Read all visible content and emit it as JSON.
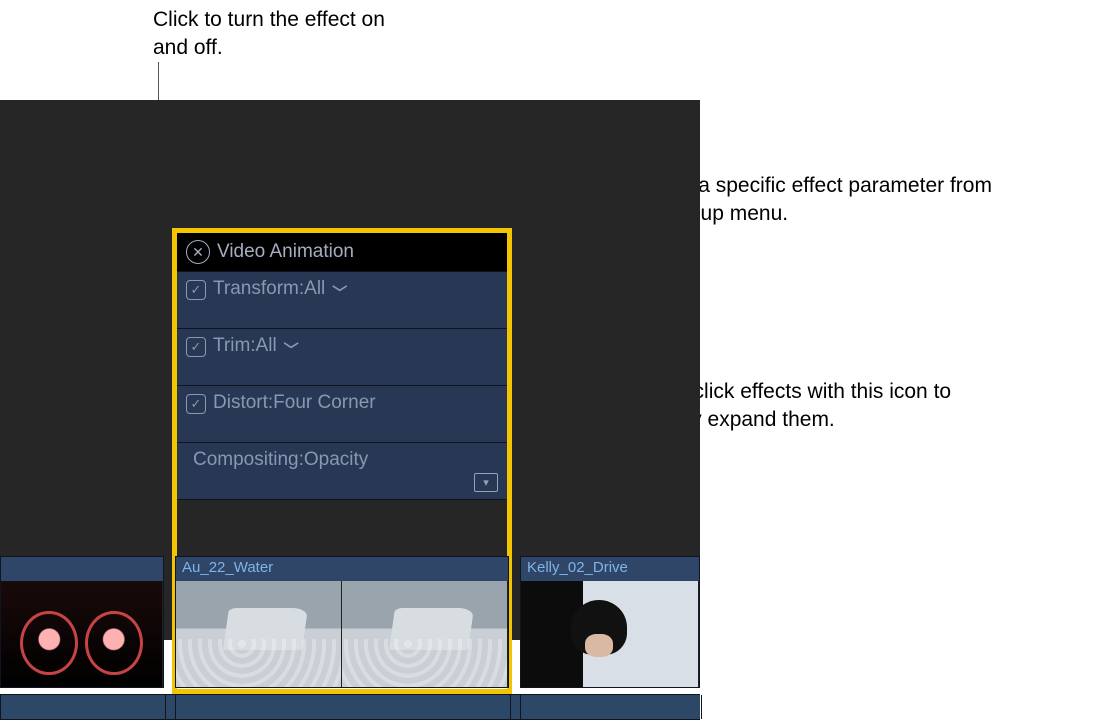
{
  "callouts": {
    "top": "Click to turn the effect on and off.",
    "right1": "Choose a specific effect parameter from this pop-up menu.",
    "right2": "Double-click effects with this icon to vertically expand them."
  },
  "panel": {
    "title": "Video Animation",
    "rows": {
      "transform": "Transform:All",
      "trim": "Trim:All",
      "distort": "Distort:Four Corner",
      "compositing": "Compositing:Opacity"
    }
  },
  "clips": {
    "left_label": "",
    "center_label": "Au_22_Water",
    "right_label": "Kelly_02_Drive"
  }
}
